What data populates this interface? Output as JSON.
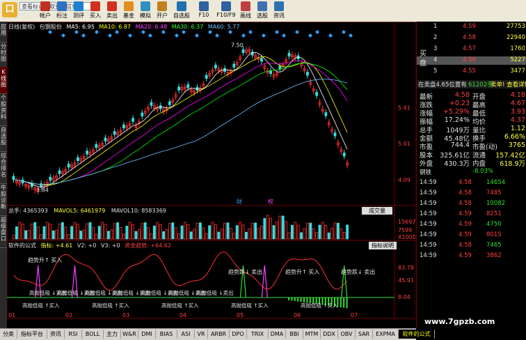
{
  "toolbar": {
    "logo": "口",
    "info_input": "查看标识获取更多信息",
    "buttons": [
      "帐户",
      "桁注",
      "测评",
      "买入",
      "卖出",
      "基金",
      "模拟",
      "开户",
      "自选股",
      "F10",
      "F10/F9",
      "画线",
      "选股",
      "资讯"
    ]
  },
  "left_tabs": [
    "应用",
    "分时图",
    "K线图",
    "个股资料",
    "自选股",
    "综合排名",
    "牛股诊断",
    "超级盘口"
  ],
  "chart_header": {
    "period": "日线(复权)",
    "stock": "包钢股份",
    "ma5": "MA5: 6.95",
    "ma10": "MA10: 6.87",
    "ma20": "MA20: 6.48",
    "ma30": "MA30: 6.37",
    "ma60": "MA60: 5.77"
  },
  "price_chart": {
    "price_axis": [
      "5.91",
      "5.01",
      "4.09"
    ],
    "high_label": "7.50",
    "low_label": "3.84",
    "markers": [
      "财",
      "权"
    ]
  },
  "volume_header": {
    "total": "总手: 4365393",
    "mavol5": "MAVOL5: 6461979",
    "mavol10": "MAVOL10: 8583369",
    "button": "成交量",
    "axis": [
      "15697",
      "7599",
      "X1000"
    ]
  },
  "indicator_header": {
    "name": "软件的公式",
    "indicator": "指标: +4.61",
    "v2": "V2: +0",
    "v3": "V3: +0",
    "fund": "资金趋势: +64.62",
    "button": "指标说明",
    "axis": [
      "83.78",
      "45.91",
      "8.04"
    ]
  },
  "signal_labels": {
    "trend_up": "趋势升↑ 买入",
    "trend_down": "趋势跌↓ 卖出",
    "high_sell": "高抛低吸 ↓卖出",
    "low_buy": "高抛低吸 ↑买入"
  },
  "date_axis": [
    "01",
    "02",
    "03",
    "04",
    "05",
    "06",
    "07"
  ],
  "order_book": {
    "sell": [
      {
        "level": "1",
        "price": "4.59",
        "vol": "27753"
      },
      {
        "level": "2",
        "price": "4.58",
        "vol": "22940"
      },
      {
        "level": "3",
        "price": "4.57",
        "vol": "1760"
      },
      {
        "level": "4",
        "price": "4.56",
        "vol": "5227"
      },
      {
        "level": "5",
        "price": "4.55",
        "vol": "3477"
      }
    ],
    "buy_label": "买盘"
  },
  "summary_bar": {
    "left": "在卖盘4.65位置有",
    "mid": "61202手",
    "right": "卖单! 查看详情"
  },
  "stats": [
    {
      "k": "最新",
      "v": "4.58",
      "k2": "开盘",
      "v2": "4.18"
    },
    {
      "k": "涨跌",
      "v": "+0.23",
      "k2": "最高",
      "v2": "4.67"
    },
    {
      "k": "涨幅",
      "v": "+5.29%",
      "k2": "最低",
      "v2": "3.93"
    },
    {
      "k": "振幅",
      "v": "17.24%",
      "k2": "均价",
      "v2": "4.37"
    },
    {
      "k": "总手",
      "v": "1049万",
      "k2": "量比",
      "v2": "1.12"
    },
    {
      "k": "金额",
      "v": "45.48亿",
      "k2": "换手",
      "v2": "6.66%"
    },
    {
      "k": "市盈",
      "v": "744.4",
      "k2": "市盈(动)",
      "v2": "3765"
    },
    {
      "k": "股本",
      "v": "325.61亿",
      "k2": "流通",
      "v2": "157.42亿"
    },
    {
      "k": "外盘",
      "v": "430.3万",
      "k2": "内盘",
      "v2": "618.9万"
    }
  ],
  "ticks_header": {
    "left": "钢铁",
    "right": "-8.03%"
  },
  "ticks": [
    {
      "t": "14:59",
      "p": "4.58",
      "v": "14654"
    },
    {
      "t": "14:59",
      "p": "4.58",
      "v": "7485"
    },
    {
      "t": "14:59",
      "p": "4.58",
      "v": "10082"
    },
    {
      "t": "14:59",
      "p": "4.59",
      "v": "8251"
    },
    {
      "t": "14:59",
      "p": "4.59",
      "v": "4750"
    },
    {
      "t": "14:59",
      "p": "4.59",
      "v": "8015"
    },
    {
      "t": "14:59",
      "p": "4.58",
      "v": "7465"
    },
    {
      "t": "14:59",
      "p": "4.59",
      "v": "3862"
    }
  ],
  "bottom_tabs": [
    "分类",
    "指标平台",
    "资讯",
    "RSI",
    "BOLL",
    "主力",
    "W&R",
    "DMI",
    "BIAS",
    "ASI",
    "VR",
    "ARBR",
    "DPO",
    "TRIX",
    "DMA",
    "BBI",
    "MTM",
    "DDX",
    "OBV",
    "SAR",
    "EXPMA",
    "软件的公式"
  ],
  "watermark": "www.7gpzb.com",
  "colors": {
    "up": "#ff3030",
    "down": "#00e0e0",
    "ma5": "#ffffff",
    "ma10": "#ffff00",
    "ma20": "#ff00ff",
    "ma30": "#00ff00",
    "ma60": "#70c0ff"
  }
}
